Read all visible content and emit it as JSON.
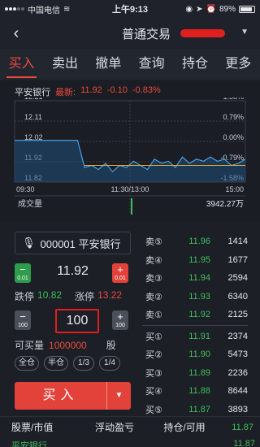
{
  "status_bar": {
    "carrier": "中国电信",
    "time": "上午9:13",
    "battery": "89%",
    "battery_level": 0.89
  },
  "nav": {
    "title": "普通交易"
  },
  "tabs": [
    {
      "label": "买入",
      "active": true
    },
    {
      "label": "卖出",
      "active": false
    },
    {
      "label": "撤单",
      "active": false
    },
    {
      "label": "查询",
      "active": false
    },
    {
      "label": "持仓",
      "active": false
    },
    {
      "label": "更多",
      "active": false
    }
  ],
  "chart_header": {
    "stock_name": "平安银行",
    "latest_label": "最新:",
    "latest_price": "11.92",
    "change": "-0.10",
    "change_pct": "-0.83%"
  },
  "chart_data": {
    "type": "line",
    "y_ticks_left": [
      "12.21",
      "12.11",
      "12.02",
      "11.92",
      "11.82"
    ],
    "y_ticks_right": [
      "1.58%",
      "0.79%",
      "0.00%",
      "-0.79%",
      "-1.58%"
    ],
    "x_ticks": [
      "09:30",
      "11:30/13:00",
      "15:00"
    ],
    "ylim": [
      11.82,
      12.21
    ],
    "series": [
      {
        "values": [
          12.02,
          12.02,
          12.02,
          12.02,
          12.02,
          12.02,
          12.02,
          12.02,
          12.02,
          12.02,
          11.89,
          11.9,
          11.88,
          11.91,
          11.87,
          11.9,
          11.89,
          11.92,
          11.9,
          11.88,
          11.93,
          11.91,
          11.92,
          11.89,
          11.94,
          11.91,
          11.93,
          11.92,
          11.94,
          11.92,
          11.93,
          11.9,
          11.91,
          11.93
        ]
      }
    ],
    "avg_line_value": 11.9,
    "volume_label": "成交量",
    "volume_value": "3942.27万"
  },
  "order_form": {
    "stock": "000001 平安银行",
    "price": "11.92",
    "price_minus": "−",
    "price_plus": "+",
    "price_step": "0.01",
    "limit_down_label": "跌停",
    "limit_down": "10.82",
    "limit_up_label": "涨停",
    "limit_up": "13.22",
    "quantity": "100",
    "qty_step": "100",
    "available_label": "可买量",
    "available": "1000000",
    "unit": "股",
    "ratio_buttons": [
      "全仓",
      "半仓",
      "1/3",
      "1/4"
    ],
    "buy_label": "买入"
  },
  "order_book": {
    "asks": [
      {
        "label": "卖⑤",
        "price": "11.96",
        "volume": "1414"
      },
      {
        "label": "卖④",
        "price": "11.95",
        "volume": "1677"
      },
      {
        "label": "卖③",
        "price": "11.94",
        "volume": "2594"
      },
      {
        "label": "卖②",
        "price": "11.93",
        "volume": "6340"
      },
      {
        "label": "卖①",
        "price": "11.92",
        "volume": "2125"
      }
    ],
    "bids": [
      {
        "label": "买①",
        "price": "11.91",
        "volume": "2374"
      },
      {
        "label": "买②",
        "price": "11.90",
        "volume": "5473"
      },
      {
        "label": "买③",
        "price": "11.89",
        "volume": "2236"
      },
      {
        "label": "买④",
        "price": "11.88",
        "volume": "8644"
      },
      {
        "label": "买⑤",
        "price": "11.87",
        "volume": "3893"
      }
    ]
  },
  "positions_header": {
    "col1": "股票/市值",
    "col2": "浮动盈亏",
    "col3": "持仓/可用",
    "col4": "11.87",
    "row2_left": "平安银行",
    "row2_right": "11.87"
  }
}
